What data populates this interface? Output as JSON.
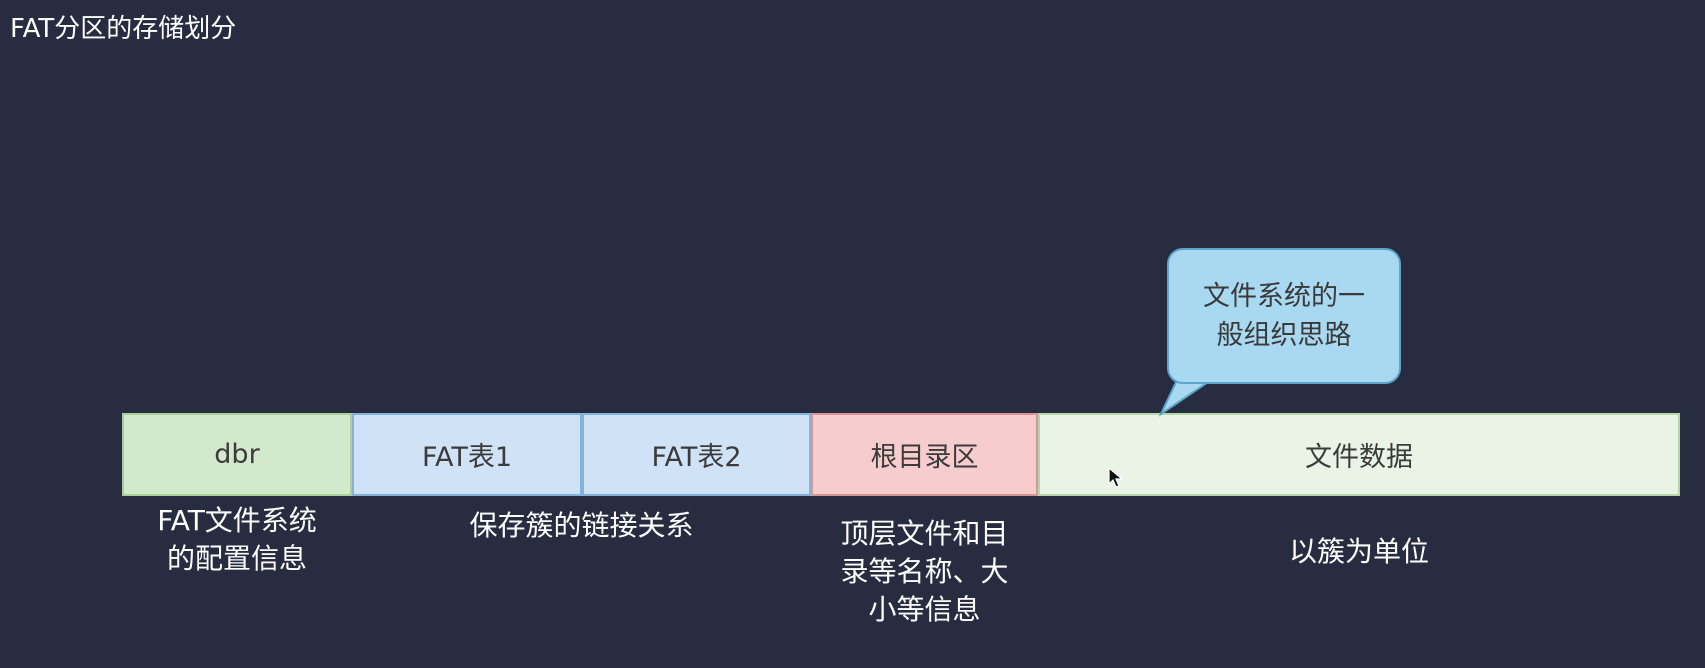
{
  "title": "FAT分区的存储划分",
  "segments": [
    {
      "label": "dbr",
      "fill": "#d3e9cc",
      "border": "#a9cf9a"
    },
    {
      "label": "FAT表1",
      "fill": "#cfe2f6",
      "border": "#84b2d8"
    },
    {
      "label": "FAT表2",
      "fill": "#cfe2f6",
      "border": "#84b2d8"
    },
    {
      "label": "根目录区",
      "fill": "#f7cccc",
      "border": "#d79595"
    },
    {
      "label": "文件数据",
      "fill": "#e9f3e6",
      "border": "#b7d7a8"
    }
  ],
  "descriptions": {
    "dbr": [
      "FAT文件系统",
      "的配置信息"
    ],
    "fat": [
      "保存簇的链接关系"
    ],
    "root": [
      "顶层文件和目",
      "录等名称、大",
      "小等信息"
    ],
    "data": [
      "以簇为单位"
    ]
  },
  "callout": {
    "lines": [
      "文件系统的一",
      "般组织思路"
    ],
    "fill": "#a9d9f1",
    "border": "#5ea5cc"
  },
  "colors": {
    "background": "#282c41",
    "text_light": "#ffffff",
    "text_dark": "#3b3b3b"
  }
}
